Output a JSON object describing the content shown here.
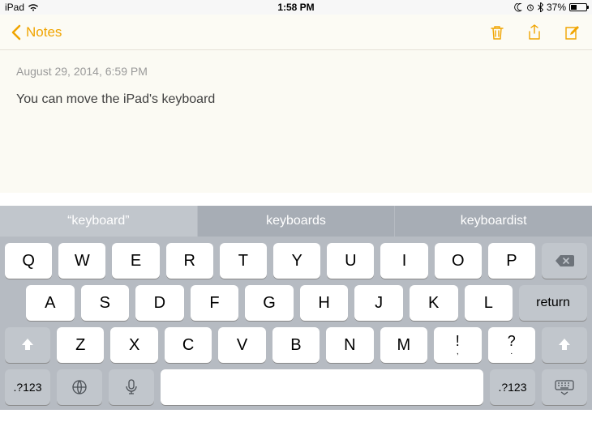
{
  "status": {
    "device": "iPad",
    "time": "1:58 PM",
    "battery_pct": "37%"
  },
  "nav": {
    "back_label": "Notes"
  },
  "note": {
    "date": "August 29, 2014, 6:59 PM",
    "text": "You can move the iPad's keyboard"
  },
  "suggestions": [
    "“keyboard”",
    "keyboards",
    "keyboardist"
  ],
  "keys": {
    "row1": [
      "Q",
      "W",
      "E",
      "R",
      "T",
      "Y",
      "U",
      "I",
      "O",
      "P"
    ],
    "row2": [
      "A",
      "S",
      "D",
      "F",
      "G",
      "H",
      "J",
      "K",
      "L"
    ],
    "row3": [
      "Z",
      "X",
      "C",
      "V",
      "B",
      "N",
      "M"
    ],
    "return": "return",
    "numswitch": ".?123",
    "punct1_top": "!",
    "punct1_bot": ",",
    "punct2_top": "?",
    "punct2_bot": "."
  }
}
